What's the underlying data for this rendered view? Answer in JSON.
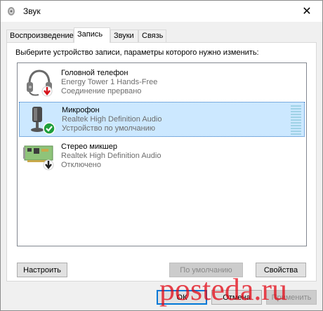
{
  "window": {
    "title": "Звук"
  },
  "tabs": [
    {
      "label": "Воспроизведение",
      "active": false
    },
    {
      "label": "Запись",
      "active": true
    },
    {
      "label": "Звуки",
      "active": false
    },
    {
      "label": "Связь",
      "active": false
    }
  ],
  "instruction": "Выберите устройство записи, параметры которого нужно изменить:",
  "devices": [
    {
      "name": "Головной телефон",
      "driver": "Energy Tower 1 Hands-Free",
      "status": "Соединение прервано",
      "icon": "headset-icon",
      "badge": "disconnected-badge-icon",
      "selected": false
    },
    {
      "name": "Микрофон",
      "driver": "Realtek High Definition Audio",
      "status": "Устройство по умолчанию",
      "icon": "microphone-icon",
      "badge": "default-check-badge-icon",
      "selected": true
    },
    {
      "name": "Стерео микшер",
      "driver": "Realtek High Definition Audio",
      "status": "Отключено",
      "icon": "sound-card-icon",
      "badge": "disabled-down-arrow-badge-icon",
      "selected": false
    }
  ],
  "buttons": {
    "configure": "Настроить",
    "set_default": "По умолчанию",
    "properties": "Свойства",
    "ok": "ОК",
    "cancel": "Отмена",
    "apply": "Применить"
  },
  "watermark": {
    "text": "posteda.ru"
  },
  "colors": {
    "selection": "#cce8ff",
    "accent": "#0078d7",
    "check_green": "#1e9e3a",
    "watermark_red": "#e30613"
  }
}
